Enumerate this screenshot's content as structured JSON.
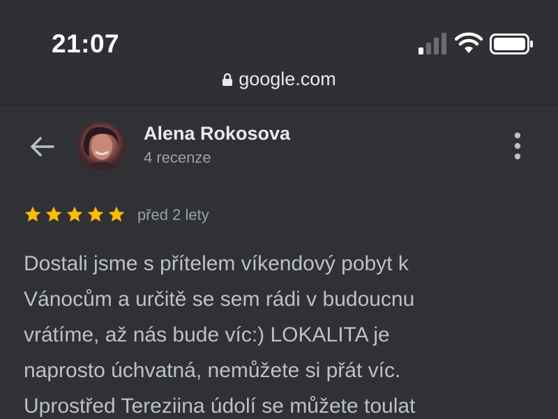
{
  "status_bar": {
    "time": "21:07",
    "icons": [
      "signal-icon",
      "wifi-icon",
      "battery-icon"
    ]
  },
  "url_bar": {
    "domain": "google.com",
    "icon": "lock-icon"
  },
  "profile": {
    "name": "Alena Rokosova",
    "reviews_count": "4 recenze",
    "back_icon": "back-arrow-icon",
    "menu_icon": "more-vert-icon"
  },
  "review": {
    "rating": 5,
    "max_rating": 5,
    "date": "před 2 lety",
    "text_lines": [
      "Dostali jsme s přítelem víkendový pobyt k",
      "Vánocům a určitě se sem rádi v budoucnu",
      "vrátíme, až nás bude víc:) LOKALITA je",
      "naprosto úchvatná, nemůžete si přát víc.",
      "Uprostřed Tereziina údolí se můžete toulat"
    ]
  },
  "colors": {
    "background": "#303134",
    "star": "#fbbc04",
    "primary_text": "#e8eaed",
    "secondary_text": "#9aa0a6"
  }
}
